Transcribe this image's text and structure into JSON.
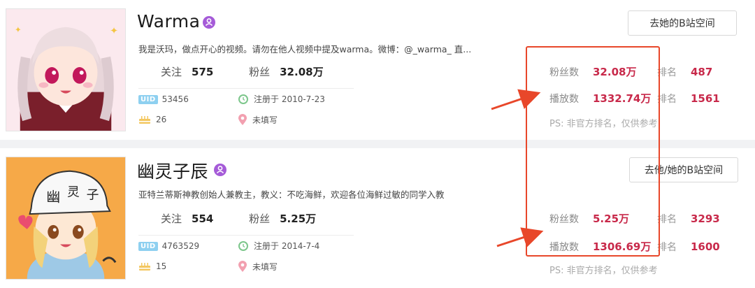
{
  "colors": {
    "accent_red": "#c8294a",
    "highlight": "#e8472a",
    "verify_purple": "#a55bd8",
    "uid_blue": "#8ed0f0",
    "calendar_green": "#7cc68b",
    "location_pink": "#f2a0b0",
    "level_gold": "#f3c760"
  },
  "profiles": [
    {
      "name": "Warma",
      "verify_icon": "verified-badge-icon",
      "bio": "我是沃玛，做点开心的视频。请勿在他人视频中提及warma。微博：@_warma_ 直...",
      "follow_label": "关注",
      "follow_count": "575",
      "fans_label": "粉丝",
      "fans_count": "32.08万",
      "uid_badge": "UID",
      "uid": "53456",
      "registered": "注册于 2010-7-23",
      "level": "26",
      "location": "未填写",
      "space_button": "去她的B站空间",
      "stats": {
        "fans_label": "粉丝数",
        "fans_value": "32.08万",
        "fans_rank_label": "排名",
        "fans_rank": "487",
        "plays_label": "播放数",
        "plays_value": "1332.74万",
        "plays_rank_label": "排名",
        "plays_rank": "1561",
        "ps": "PS: 非官方排名，仅供参考"
      }
    },
    {
      "name": "幽灵子辰",
      "verify_icon": "verified-badge-icon",
      "bio": "亚特兰蒂斯神教创始人兼教主，教义：不吃海鲜，欢迎各位海鲜过敏的同学入教",
      "follow_label": "关注",
      "follow_count": "554",
      "fans_label": "粉丝",
      "fans_count": "5.25万",
      "uid_badge": "UID",
      "uid": "4763529",
      "registered": "注册于 2014-7-4",
      "level": "15",
      "location": "未填写",
      "space_button": "去他/她的B站空间",
      "stats": {
        "fans_label": "粉丝数",
        "fans_value": "5.25万",
        "fans_rank_label": "排名",
        "fans_rank": "3293",
        "plays_label": "播放数",
        "plays_value": "1306.69万",
        "plays_rank_label": "排名",
        "plays_rank": "1600",
        "ps": "PS: 非官方排名，仅供参考"
      }
    }
  ]
}
